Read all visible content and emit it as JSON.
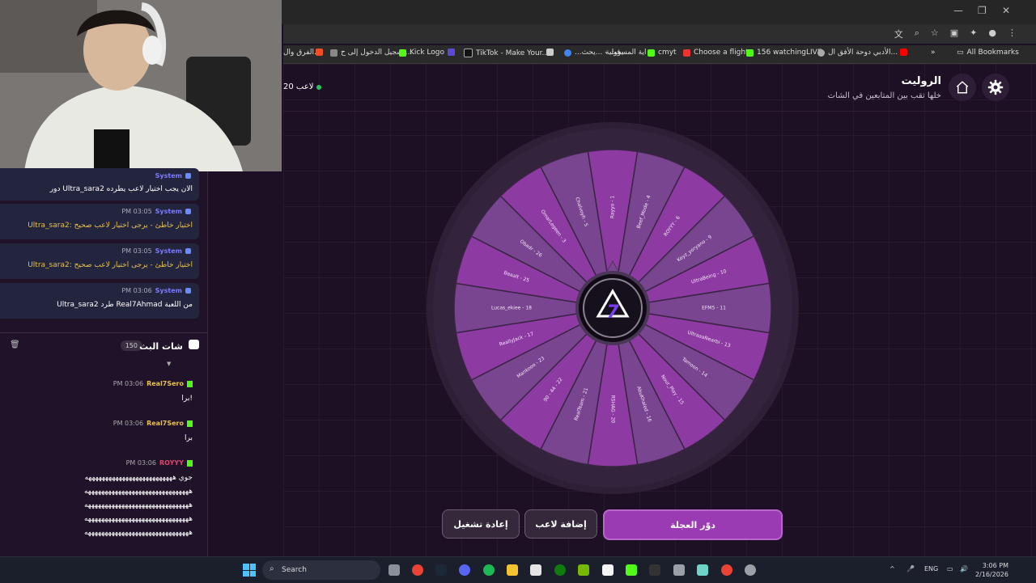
{
  "browser": {
    "bookmarks": [
      {
        "label": "الفرق وال..."
      },
      {
        "label": ""
      },
      {
        "label": "تسجيل الدخول إلى ح..."
      },
      {
        "label": "Kick Logo"
      },
      {
        "label": ""
      },
      {
        "label": "TikTok - Make Your..."
      },
      {
        "label": ""
      },
      {
        "label": "...يحث - ...يحث"
      },
      {
        "label": "اية المسؤولية"
      },
      {
        "label": "cmyt"
      },
      {
        "label": "Choose a flight"
      },
      {
        "label": "156 watchingLIVE"
      },
      {
        "label": "الأدبي دوحة الأفق ال..."
      },
      {
        "label": ""
      }
    ],
    "all_bookmarks_label": "All Bookmarks",
    "more_label": "»"
  },
  "header": {
    "title": "الروليت",
    "subtitle": "خلها تقب بين المتابعين في الشات",
    "players_count": "20 لاعب"
  },
  "wheel": {
    "segments": [
      "Rayyo - 1",
      "Beef_Mode - 4",
      "ROYYY - 6",
      "Keyz_yoryano - 9",
      "UltraBeing - 10",
      "EFM5 - 11",
      "UltraaaNearbi - 13",
      "Tamoon - 14",
      "Nour_Play - 15",
      "AbuKhaled - 16",
      "RSHAG - 20",
      "RealTeam - 21",
      "90 - 44 - 22",
      "Mankooo - 23",
      "ReallyJack - 17",
      "Lucas_ekiee - 18",
      "Beaalt - 25",
      "Obadr - 26",
      "OmarLegeen - 3",
      "Chalvoyh - 5"
    ],
    "colors": [
      "#8e3aa3",
      "#7a4590"
    ]
  },
  "buttons": {
    "spin": "دوّر العجلة",
    "add_player": "إضافة لاعب",
    "restart": "إعادة تشغيل"
  },
  "chat": {
    "system_messages": [
      {
        "sender": "System",
        "time": "",
        "text": "دور Ultra_sara2 الان يجب اختيار لاعب يطرده",
        "color": "#ffffff"
      },
      {
        "sender": "System",
        "time": "PM 03:05",
        "text": "Ultra_sara2: اختيار خاطئ - يرجى اختيار لاعب صحيح",
        "color": "#e8c14b"
      },
      {
        "sender": "System",
        "time": "PM 03:05",
        "text": "Ultra_sara2: اختيار خاطئ - يرجى اختيار لاعب صحيح",
        "color": "#e8c14b"
      },
      {
        "sender": "System",
        "time": "PM 03:06",
        "text": "Ultra_sara2 طرد Real7Ahmad من اللعبة",
        "color": "#ffffff"
      }
    ],
    "title": "شات البث",
    "count": "150",
    "messages": [
      {
        "user": "Real7Sero",
        "time": "PM 03:06",
        "lines": [
          "برا!"
        ]
      },
      {
        "user": "Real7Sero",
        "time": "PM 03:06",
        "lines": [
          "برا"
        ]
      },
      {
        "user": "ROYYY",
        "time": "PM 03:06",
        "lines": [
          "جوي ههههههههههههههههههههههههههه",
          "هههههههههههههههههههههههههههههههه",
          "هههههههههههههههههههههههههههههههه",
          "هههههههههههههههههههههههههههههههه",
          "هههههههههههههههههههههههههههههههه"
        ]
      }
    ]
  },
  "taskbar": {
    "search_placeholder": "Search",
    "lang": "ENG",
    "time": "3:06 PM",
    "date": "2/16/2026"
  }
}
